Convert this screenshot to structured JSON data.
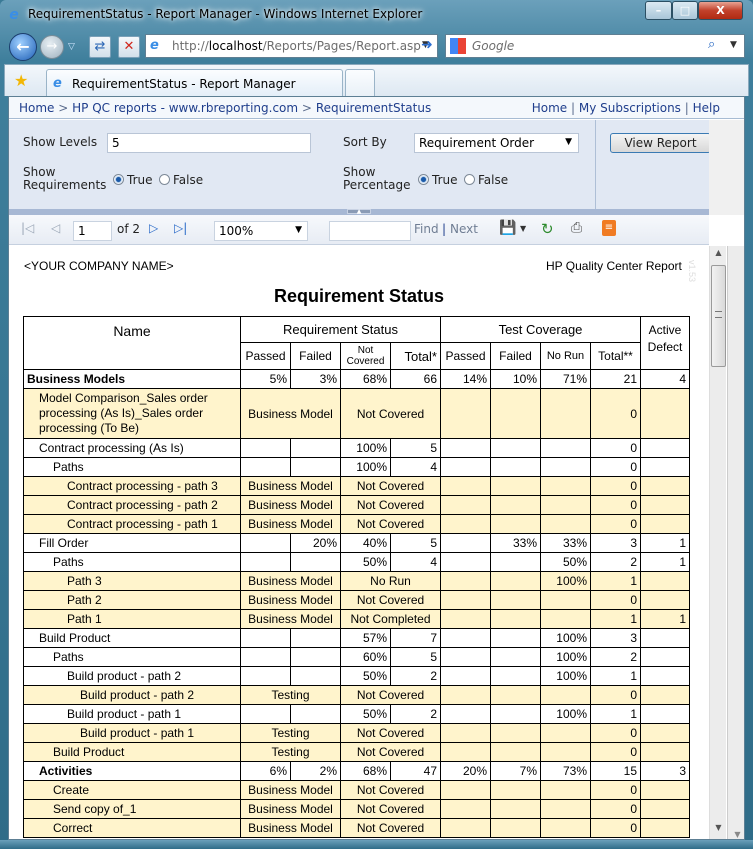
{
  "window": {
    "title": "RequirementStatus - Report Manager - Windows Internet Explorer",
    "controls": {
      "minimize": "–",
      "maximize": "□",
      "close": "X"
    }
  },
  "browser": {
    "address_prefix": "http://",
    "address_host": "localhost",
    "address_path": "/Reports/Pages/Report.asp",
    "search_placeholder": "Google",
    "tab_label": "RequirementStatus - Report Manager"
  },
  "breadcrumb": {
    "items": [
      "Home",
      "HP QC reports - www.rbreporting.com",
      "RequirementStatus"
    ],
    "separator": ">"
  },
  "toplinks": [
    "Home",
    "My Subscriptions",
    "Help"
  ],
  "params": {
    "show_levels_label": "Show Levels",
    "show_levels_value": "5",
    "sort_by_label": "Sort By",
    "sort_by_value": "Requirement Order",
    "show_requirements_label_1": "Show",
    "show_requirements_label_2": "Requirements",
    "show_requirements_value": true,
    "show_percentage_label_1": "Show",
    "show_percentage_label_2": "Percentage",
    "show_percentage_value": true,
    "true_label": "True",
    "false_label": "False",
    "view_report_label": "View Report"
  },
  "toolbar": {
    "page_current": "1",
    "page_of": "of 2",
    "zoom": "100%",
    "find_value": "",
    "find_label": "Find",
    "find_sep": "|",
    "next_label": "Next"
  },
  "report": {
    "company": "<YOUR COMPANY NAME>",
    "source": "HP Quality Center Report",
    "version": "v1.53",
    "title": "Requirement Status",
    "headers": {
      "name": "Name",
      "req_status": "Requirement Status",
      "test_coverage": "Test Coverage",
      "active_defect_1": "Active",
      "active_defect_2": "Defect",
      "rs_passed": "Passed",
      "rs_failed": "Failed",
      "rs_not_covered_1": "Not",
      "rs_not_covered_2": "Covered",
      "rs_total": "Total*",
      "tc_passed": "Passed",
      "tc_failed": "Failed",
      "tc_no_run": "No Run",
      "tc_total": "Total**"
    },
    "rows": [
      {
        "type": "group",
        "level": 0,
        "name": "Business Models",
        "rs_passed": "5%",
        "rs_failed": "3%",
        "rs_not_covered": "68%",
        "rs_total": "66",
        "tc_passed": "14%",
        "tc_failed": "10%",
        "tc_no_run": "71%",
        "tc_total": "21",
        "defects": "4"
      },
      {
        "type": "leaf",
        "level": 1,
        "name": "Model Comparison_Sales order processing (As Is)_Sales order processing (To Be)",
        "req_type": "Business Model",
        "status": "Not Covered",
        "tc_passed": "",
        "tc_failed": "",
        "tc_no_run": "",
        "tc_total": "0",
        "defects": ""
      },
      {
        "type": "req",
        "level": 1,
        "name": "Contract processing (As Is)",
        "rs_passed": "",
        "rs_failed": "",
        "rs_not_covered": "100%",
        "rs_total": "5",
        "tc_passed": "",
        "tc_failed": "",
        "tc_no_run": "",
        "tc_total": "0",
        "defects": ""
      },
      {
        "type": "req",
        "level": 2,
        "name": "Paths",
        "rs_passed": "",
        "rs_failed": "",
        "rs_not_covered": "100%",
        "rs_total": "4",
        "tc_passed": "",
        "tc_failed": "",
        "tc_no_run": "",
        "tc_total": "0",
        "defects": ""
      },
      {
        "type": "leaf",
        "level": 3,
        "name": "Contract processing - path 3",
        "req_type": "Business Model",
        "status": "Not Covered",
        "tc_passed": "",
        "tc_failed": "",
        "tc_no_run": "",
        "tc_total": "0",
        "defects": ""
      },
      {
        "type": "leaf",
        "level": 3,
        "name": "Contract processing - path 2",
        "req_type": "Business Model",
        "status": "Not Covered",
        "tc_passed": "",
        "tc_failed": "",
        "tc_no_run": "",
        "tc_total": "0",
        "defects": ""
      },
      {
        "type": "leaf",
        "level": 3,
        "name": "Contract processing - path 1",
        "req_type": "Business Model",
        "status": "Not Covered",
        "tc_passed": "",
        "tc_failed": "",
        "tc_no_run": "",
        "tc_total": "0",
        "defects": ""
      },
      {
        "type": "req",
        "level": 1,
        "name": "Fill Order",
        "rs_passed": "",
        "rs_failed": "20%",
        "rs_not_covered": "40%",
        "rs_total": "5",
        "tc_passed": "",
        "tc_failed": "33%",
        "tc_no_run": "33%",
        "tc_total": "3",
        "defects": "1"
      },
      {
        "type": "req",
        "level": 2,
        "name": "Paths",
        "rs_passed": "",
        "rs_failed": "",
        "rs_not_covered": "50%",
        "rs_total": "4",
        "tc_passed": "",
        "tc_failed": "",
        "tc_no_run": "50%",
        "tc_total": "2",
        "defects": "1"
      },
      {
        "type": "leaf",
        "level": 3,
        "name": "Path 3",
        "req_type": "Business Model",
        "status": "No Run",
        "tc_passed": "",
        "tc_failed": "",
        "tc_no_run": "100%",
        "tc_total": "1",
        "defects": ""
      },
      {
        "type": "leaf",
        "level": 3,
        "name": "Path 2",
        "req_type": "Business Model",
        "status": "Not Covered",
        "tc_passed": "",
        "tc_failed": "",
        "tc_no_run": "",
        "tc_total": "0",
        "defects": ""
      },
      {
        "type": "leaf",
        "level": 3,
        "name": "Path 1",
        "req_type": "Business Model",
        "status": "Not Completed",
        "tc_passed": "",
        "tc_failed": "",
        "tc_no_run": "",
        "tc_total": "1",
        "defects": "1"
      },
      {
        "type": "req",
        "level": 1,
        "name": "Build Product",
        "rs_passed": "",
        "rs_failed": "",
        "rs_not_covered": "57%",
        "rs_total": "7",
        "tc_passed": "",
        "tc_failed": "",
        "tc_no_run": "100%",
        "tc_total": "3",
        "defects": ""
      },
      {
        "type": "req",
        "level": 2,
        "name": "Paths",
        "rs_passed": "",
        "rs_failed": "",
        "rs_not_covered": "60%",
        "rs_total": "5",
        "tc_passed": "",
        "tc_failed": "",
        "tc_no_run": "100%",
        "tc_total": "2",
        "defects": ""
      },
      {
        "type": "req",
        "level": 3,
        "name": "Build product - path 2",
        "rs_passed": "",
        "rs_failed": "",
        "rs_not_covered": "50%",
        "rs_total": "2",
        "tc_passed": "",
        "tc_failed": "",
        "tc_no_run": "100%",
        "tc_total": "1",
        "defects": ""
      },
      {
        "type": "leaf",
        "level": 4,
        "name": "Build product - path 2",
        "req_type": "Testing",
        "status": "Not Covered",
        "tc_passed": "",
        "tc_failed": "",
        "tc_no_run": "",
        "tc_total": "0",
        "defects": ""
      },
      {
        "type": "req",
        "level": 3,
        "name": "Build product - path 1",
        "rs_passed": "",
        "rs_failed": "",
        "rs_not_covered": "50%",
        "rs_total": "2",
        "tc_passed": "",
        "tc_failed": "",
        "tc_no_run": "100%",
        "tc_total": "1",
        "defects": ""
      },
      {
        "type": "leaf",
        "level": 4,
        "name": "Build product - path 1",
        "req_type": "Testing",
        "status": "Not Covered",
        "tc_passed": "",
        "tc_failed": "",
        "tc_no_run": "",
        "tc_total": "0",
        "defects": ""
      },
      {
        "type": "leaf",
        "level": 2,
        "name": "Build Product",
        "req_type": "Testing",
        "status": "Not Covered",
        "tc_passed": "",
        "tc_failed": "",
        "tc_no_run": "",
        "tc_total": "0",
        "defects": ""
      },
      {
        "type": "group",
        "level": 1,
        "name": "Activities",
        "rs_passed": "6%",
        "rs_failed": "2%",
        "rs_not_covered": "68%",
        "rs_total": "47",
        "tc_passed": "20%",
        "tc_failed": "7%",
        "tc_no_run": "73%",
        "tc_total": "15",
        "defects": "3"
      },
      {
        "type": "leaf",
        "level": 2,
        "name": "Create",
        "req_type": "Business Model",
        "status": "Not Covered",
        "tc_passed": "",
        "tc_failed": "",
        "tc_no_run": "",
        "tc_total": "0",
        "defects": ""
      },
      {
        "type": "leaf",
        "level": 2,
        "name": "Send copy of_1",
        "req_type": "Business Model",
        "status": "Not Covered",
        "tc_passed": "",
        "tc_failed": "",
        "tc_no_run": "",
        "tc_total": "0",
        "defects": ""
      },
      {
        "type": "leaf",
        "level": 2,
        "name": "Correct",
        "req_type": "Business Model",
        "status": "Not Covered",
        "tc_passed": "",
        "tc_failed": "",
        "tc_no_run": "",
        "tc_total": "0",
        "defects": ""
      }
    ]
  },
  "colors": {
    "leaf_row_bg": "#fff4cc",
    "param_bg": "#e1e8f3",
    "link": "#1f3e8c"
  }
}
